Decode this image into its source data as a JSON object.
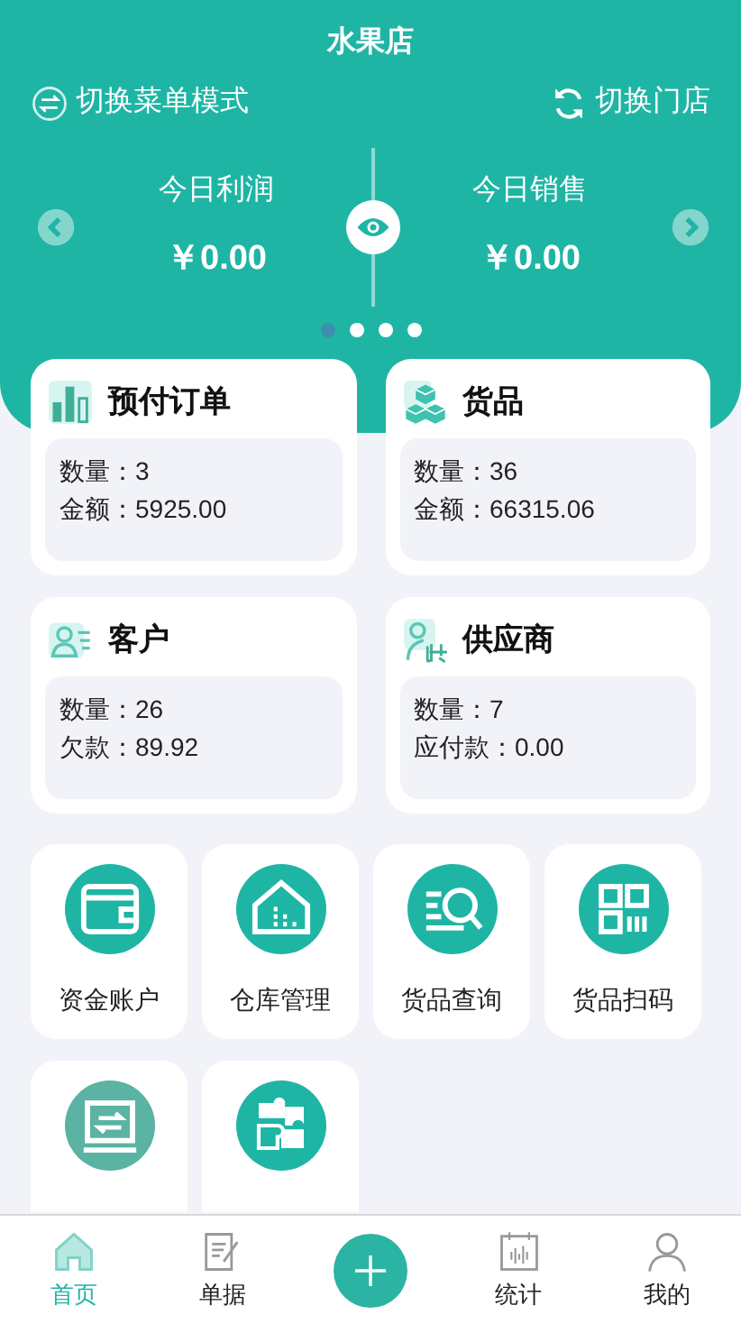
{
  "header": {
    "title": "水果店",
    "switch_menu": "切换菜单模式",
    "switch_store": "切换门店"
  },
  "summary": [
    {
      "label": "今日利润",
      "value": "￥0.00"
    },
    {
      "label": "今日销售",
      "value": "￥0.00"
    }
  ],
  "dots": [
    {
      "selected": true
    },
    {
      "selected": false
    },
    {
      "selected": false
    },
    {
      "selected": false
    }
  ],
  "cards": [
    {
      "kind": "orders",
      "title": "预付订单",
      "lines": [
        "数量：3",
        "金额：5925.00"
      ]
    },
    {
      "kind": "goods",
      "title": "货品",
      "lines": [
        "数量：36",
        "金额：66315.06"
      ]
    },
    {
      "kind": "customers",
      "title": "客户",
      "lines": [
        "数量：26",
        "欠款：89.92"
      ]
    },
    {
      "kind": "suppliers",
      "title": "供应商",
      "lines": [
        "数量：7",
        "应付款：0.00"
      ]
    }
  ],
  "tiles": [
    {
      "kind": "wallet",
      "label": "资金账户"
    },
    {
      "kind": "warehouse",
      "label": "仓库管理"
    },
    {
      "kind": "search",
      "label": "货品查询"
    },
    {
      "kind": "scan",
      "label": "货品扫码"
    },
    {
      "kind": "transfer"
    },
    {
      "kind": "puzzle"
    }
  ],
  "nav": [
    {
      "kind": "home",
      "label": "首页",
      "selected": true
    },
    {
      "kind": "doc",
      "label": "单据",
      "selected": false
    },
    {
      "kind": "add",
      "selected": false
    },
    {
      "kind": "stats",
      "label": "统计",
      "selected": false
    },
    {
      "kind": "me",
      "label": "我的",
      "selected": false
    }
  ]
}
